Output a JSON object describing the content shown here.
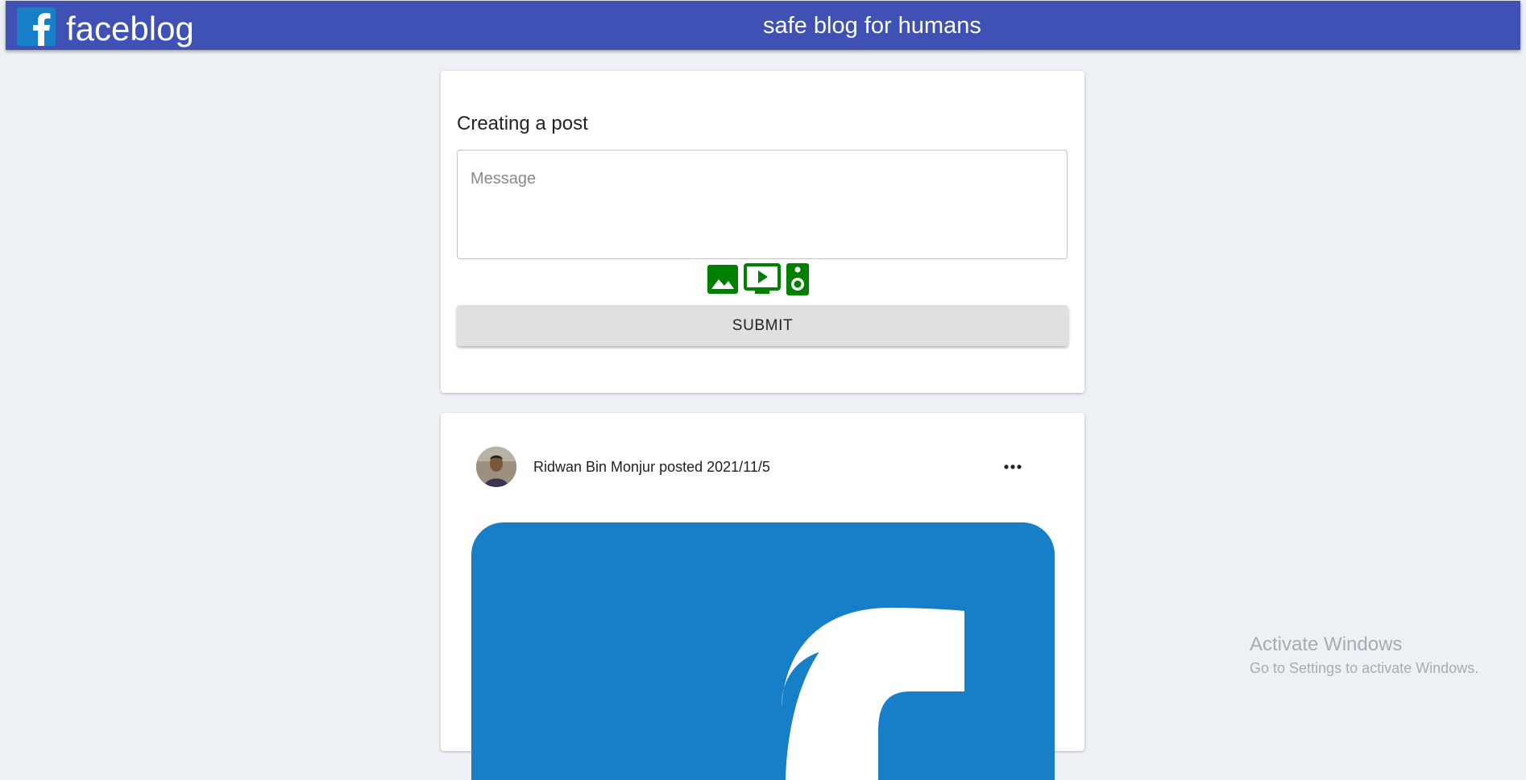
{
  "header": {
    "app_name": "faceblog",
    "tagline": "safe blog for humans",
    "logo_icon": "facebook-f-logo",
    "background_color": "#3f51b5"
  },
  "create_post": {
    "title": "Creating a post",
    "message_placeholder": "Message",
    "message_value": "",
    "media_icons": [
      "image-icon",
      "video-icon",
      "audio-speaker-icon"
    ],
    "media_icon_color": "#008000",
    "submit_label": "SUBMIT"
  },
  "post": {
    "header_text": "Ridwan Bin Monjur posted 2021/11/5",
    "more_icon": "more-horizontal-icon",
    "image_description_icon": "facebook-logo",
    "image_color": "#177ec8"
  },
  "os_watermark": {
    "title": "Activate Windows",
    "subtitle": "Go to Settings to activate Windows."
  }
}
